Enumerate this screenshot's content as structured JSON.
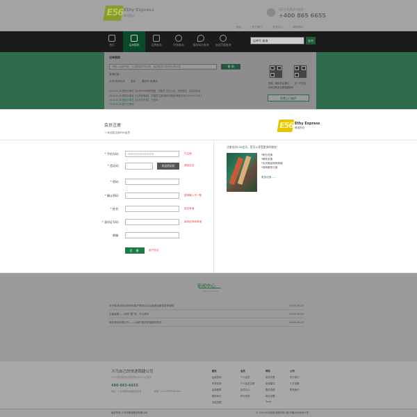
{
  "header": {
    "logo_text": "E56",
    "logo_en": "Ethy Express",
    "logo_cn": "联强物流",
    "phone_label": "365天免费咨询热线",
    "phone_number": "+400 865 6655",
    "top_links": [
      "首页",
      "关于我们",
      "会员中心",
      "联系我们"
    ]
  },
  "nav": {
    "items": [
      {
        "label": "首页",
        "icon": "home-icon"
      },
      {
        "label": "运单跟踪",
        "icon": "truck-icon"
      },
      {
        "label": "运费查询",
        "icon": "dollar-icon"
      },
      {
        "label": "时效查询",
        "icon": "clock-icon"
      },
      {
        "label": "服务网点查询",
        "icon": "location-icon"
      },
      {
        "label": "派送范围查询",
        "icon": "search-icon"
      }
    ],
    "active_index": 1,
    "search_value": "运单号 查询",
    "search_button": "查询"
  },
  "tracking": {
    "title": "运单跟踪",
    "input_placeholder": "请输入运单号码，以空格或逗号分隔，每次最多可查询30条记录",
    "query_button": "查 询",
    "records_label": "查询记录：",
    "tabs": [
      "义乌-苏州长乐",
      "发往",
      "爬行中  查询中"
    ],
    "rows": [
      {
        "text": "2014-6-16     您的订单在【义乌E56网络快递】 扫描员 正在入仓，您的签名 【发往苏州】",
        "green": false
      },
      {
        "text": "2014-6-16     您的订单在【义乌中转部】 扫描员王某  到件中转站 联系方式13579412345",
        "green": false
      },
      {
        "text": "2014-6-18     您的订单在【义乌长乐部】  已签收",
        "green": true
      },
      {
        "text": "2014-6-18     客户已签收",
        "green": true
      }
    ],
    "qr1_label": "扫描二维码关注我们",
    "qr1_sub": "手机扫码关注微信服务号",
    "qr2_label": "扫一扫关注",
    "pickup_button": "免费上门取件"
  },
  "register": {
    "title": "会员注册",
    "subtitle": "→ 欢迎您注册E56会员",
    "brand_en": "Ethy Express",
    "brand_cn": "联强物流",
    "fields": [
      {
        "label": "* 手机号码：",
        "placeholder": "请填写您的常用手机号码",
        "error": "已注册"
      },
      {
        "label": "* 验证码：",
        "placeholder": "",
        "error": "请查实法"
      },
      {
        "label": "* 密码：",
        "placeholder": "",
        "error": ""
      },
      {
        "label": "* 确认密码：",
        "placeholder": "",
        "error": "密码输入不一致"
      },
      {
        "label": "* 姓名：",
        "placeholder": "",
        "error": "姓名有误"
      },
      {
        "label": "* 身份证号码：",
        "placeholder": "",
        "error": "身份证号码有误"
      },
      {
        "label": "邮箱：",
        "placeholder": "",
        "error": ""
      }
    ],
    "code_button": "发送验证码",
    "submit_button": "注 册",
    "terms_link": "用户协议",
    "right_title_prefix": "注册成为",
    "right_title_brand": "E56会员",
    "right_title_suffix": "，您可以享受更多的服务！",
    "benefits": [
      "*积分兑换",
      "*邮件优惠",
      "*大宗商品特别商城",
      "*其他服务订阅"
    ],
    "more_link": "更多优惠......"
  },
  "news": {
    "title": "新闻中心",
    "subtitle": "NEWS CENTER",
    "items": [
      {
        "title": "关于取消中国大陆所有客户服务出口后面退运服务暂停通知",
        "date": "2014-05-25"
      },
      {
        "title": "出路途期——玩转“楼”家，开心顺丰",
        "date": "2014-05-25"
      },
      {
        "title": "顺丰速运有限公司——让我们追求质量服务精品",
        "date": "2014-05-25"
      }
    ]
  },
  "footer": {
    "company": "义乌自己的快递跑腿公司",
    "company_sub": "义乌市联强物流快递有限公司24小时服务",
    "phone": "400-865-6655",
    "address": "地址：义乌市稠州北路快递大厦",
    "email": "邮箱：yw_e56@126.com",
    "columns": [
      {
        "head": "服务",
        "items": [
          "运费查询",
          "时效查询",
          "运单跟踪",
          "服务网点",
          "派送范围",
          "派送范围查询"
        ]
      },
      {
        "head": "会员",
        "items": [
          "个人会员",
          "个人会员注册",
          "会员中心",
          "积分兑换"
        ]
      },
      {
        "head": "帮助",
        "items": [
          "常见问题",
          "投诉建议",
          "服务流程",
          "网点加盟",
          "Tools"
        ]
      },
      {
        "head": "公司",
        "items": [
          "关于我们",
          "人才招聘",
          "联系我们"
        ]
      }
    ],
    "copyright": "版权所有 义乌市联强物流有限公司",
    "icp": "© 2014 E56快递  版权所有  浙ICP备08056307号"
  }
}
